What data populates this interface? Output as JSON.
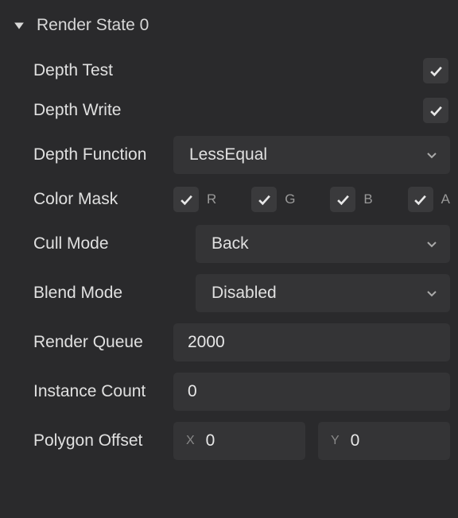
{
  "section": {
    "title": "Render State 0"
  },
  "fields": {
    "depth_test": {
      "label": "Depth Test",
      "value": true
    },
    "depth_write": {
      "label": "Depth Write",
      "value": true
    },
    "depth_function": {
      "label": "Depth Function",
      "selected": "LessEqual"
    },
    "color_mask": {
      "label": "Color Mask",
      "r": {
        "label": "R",
        "value": true
      },
      "g": {
        "label": "G",
        "value": true
      },
      "b": {
        "label": "B",
        "value": true
      },
      "a": {
        "label": "A",
        "value": true
      }
    },
    "cull_mode": {
      "label": "Cull Mode",
      "selected": "Back"
    },
    "blend_mode": {
      "label": "Blend Mode",
      "selected": "Disabled"
    },
    "render_queue": {
      "label": "Render Queue",
      "value": "2000"
    },
    "instance_count": {
      "label": "Instance Count",
      "value": "0"
    },
    "polygon_offset": {
      "label": "Polygon Offset",
      "x": {
        "prefix": "X",
        "value": "0"
      },
      "y": {
        "prefix": "Y",
        "value": "0"
      }
    }
  }
}
